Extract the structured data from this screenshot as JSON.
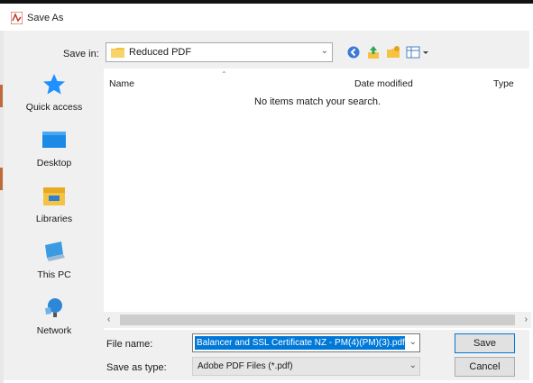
{
  "window": {
    "title": "Save As"
  },
  "save_in": {
    "label": "Save in:",
    "value": "Reduced PDF"
  },
  "toolbar": {
    "icons": [
      "back-icon",
      "up-folder-icon",
      "new-folder-icon",
      "view-menu-icon"
    ]
  },
  "places": [
    {
      "label": "Quick access",
      "icon": "star-icon"
    },
    {
      "label": "Desktop",
      "icon": "desktop-icon"
    },
    {
      "label": "Libraries",
      "icon": "libraries-icon"
    },
    {
      "label": "This PC",
      "icon": "computer-icon"
    },
    {
      "label": "Network",
      "icon": "network-icon"
    }
  ],
  "file_list": {
    "columns": [
      "Name",
      "Date modified",
      "Type"
    ],
    "empty_message": "No items match your search."
  },
  "file_name": {
    "label": "File name:",
    "value": "Balancer and SSL Certificate NZ - PM(4)(PM)(3).pdf"
  },
  "save_as_type": {
    "label": "Save as type:",
    "value": "Adobe PDF Files (*.pdf)"
  },
  "buttons": {
    "save": "Save",
    "cancel": "Cancel"
  },
  "colors": {
    "accent": "#0078d7",
    "star": "#1e90ff",
    "folder": "#f5c242"
  }
}
